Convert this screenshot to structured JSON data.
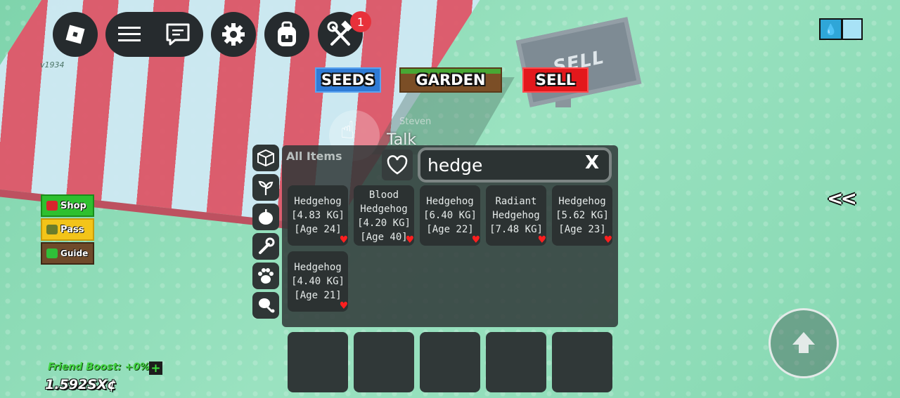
{
  "topbar": {
    "version": "v1934",
    "notification_count": "1",
    "buttons": [
      "roblox-menu",
      "chat",
      "settings",
      "backpack",
      "tools"
    ]
  },
  "world": {
    "seeds_label": "SEEDS",
    "garden_label": "GARDEN",
    "sell_label": "SELL",
    "sign_text": "SELL",
    "talk_label": "Talk",
    "npc_name": "Steven"
  },
  "left_buttons": {
    "shop": "Shop",
    "pass": "Pass",
    "guide": "Guide"
  },
  "inventory": {
    "category_title": "All Items",
    "search_value": "hedge",
    "clear_label": "X",
    "items": [
      {
        "name": "Hedgehog",
        "weight": "[4.83 KG]",
        "age": "[Age 24]"
      },
      {
        "name": "Blood Hedgehog",
        "weight": "[4.20 KG]",
        "age": "[Age 40]"
      },
      {
        "name": "Hedgehog",
        "weight": "[6.40 KG]",
        "age": "[Age 22]"
      },
      {
        "name": "Radiant Hedgehog",
        "weight": "[7.48 KG]",
        "age": ""
      },
      {
        "name": "Hedgehog",
        "weight": "[5.62 KG]",
        "age": "[Age 23]"
      },
      {
        "name": "Hedgehog",
        "weight": "[4.40 KG]",
        "age": "[Age 21]"
      }
    ]
  },
  "status": {
    "friend_boost": "Friend Boost: +0%",
    "money": "1.592SX¢"
  },
  "collapse_label": "<<",
  "colors": {
    "grass": "#8fdcb6",
    "panel": "#303838",
    "favorite": "#ff1f1f",
    "seeds": "#2f7bd6",
    "sell": "#e3181c",
    "shop": "#2ec02f",
    "pass": "#f3c419"
  }
}
